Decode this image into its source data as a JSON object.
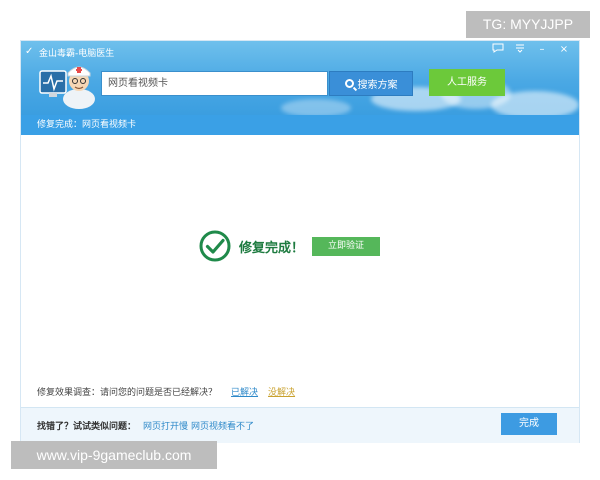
{
  "watermarks": {
    "top_right": "TG: MYYJJPP",
    "bottom_left": "www.vip-9gameclub.com"
  },
  "app": {
    "title": "金山毒霸-电脑医生"
  },
  "window_controls": {
    "feedback_icon": "speech-bubble-icon",
    "menu_icon": "menu-icon",
    "minimize": "–",
    "close": "×"
  },
  "search": {
    "value": "网页看视频卡",
    "button_label": "搜索方案"
  },
  "service_button": "人工服务",
  "breadcrumb": "修复完成：网页看视频卡",
  "result": {
    "status": "修复完成！",
    "verify_button": "立即验证"
  },
  "survey": {
    "question": "修复效果调查：请问您的问题是否已经解决？",
    "yes": "已解决",
    "no": "没解决"
  },
  "footer": {
    "prompt": "找错了？试试类似问题：",
    "links": [
      "网页打开慢",
      "网页视频看不了"
    ],
    "done_button": "完成"
  },
  "colors": {
    "header_blue": "#4aa8e4",
    "service_green": "#6cc93a",
    "success_green": "#1e7b40",
    "link_blue": "#2e89c9"
  }
}
